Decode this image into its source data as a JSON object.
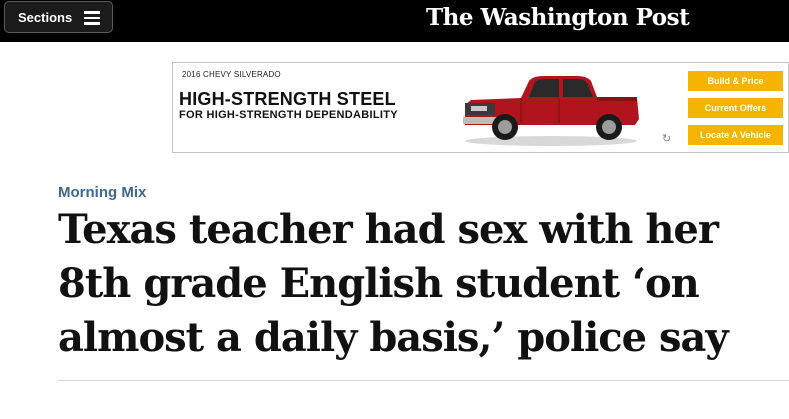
{
  "header": {
    "sections_label": "Sections",
    "masthead": "The Washington Post"
  },
  "ad": {
    "model": "2016 CHEVY SILVERADO",
    "headline": "HIGH-STRENGTH STEEL",
    "subline": "FOR HIGH-STRENGTH DEPENDABILITY",
    "buttons": [
      "Build & Price",
      "Current Offers",
      "Locate A Vehicle"
    ],
    "button_color": "#f5b400",
    "truck_color": "#b0141c",
    "refresh_icon": "refresh-icon"
  },
  "article": {
    "kicker": "Morning Mix",
    "headline": "Texas teacher had sex with her 8th grade English student ‘on almost a daily basis,’ police say",
    "kicker_color": "#3e6890"
  }
}
